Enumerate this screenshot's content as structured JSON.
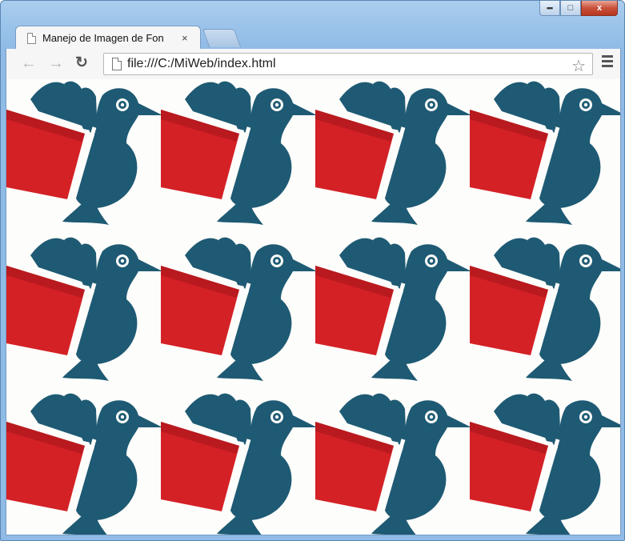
{
  "browser": {
    "tab_title": "Manejo de Imagen de Fon",
    "tab_close": "×",
    "url": "file:///C:/MiWeb/index.html",
    "back_icon": "arrow-left-icon",
    "forward_icon": "arrow-right-icon",
    "reload_icon": "reload-icon",
    "bookmark_icon": "star-icon",
    "menu_icon": "hamburger-menu-icon"
  },
  "window_controls": {
    "minimize": "minimize-icon",
    "maximize": "maximize-icon",
    "close": "x"
  },
  "page": {
    "background_image": "bird-with-red-book",
    "background_repeat": "repeat",
    "colors": {
      "book_red": "#d42126",
      "bird_teal": "#1e5a73",
      "page_bg": "#fdfdfb"
    }
  }
}
